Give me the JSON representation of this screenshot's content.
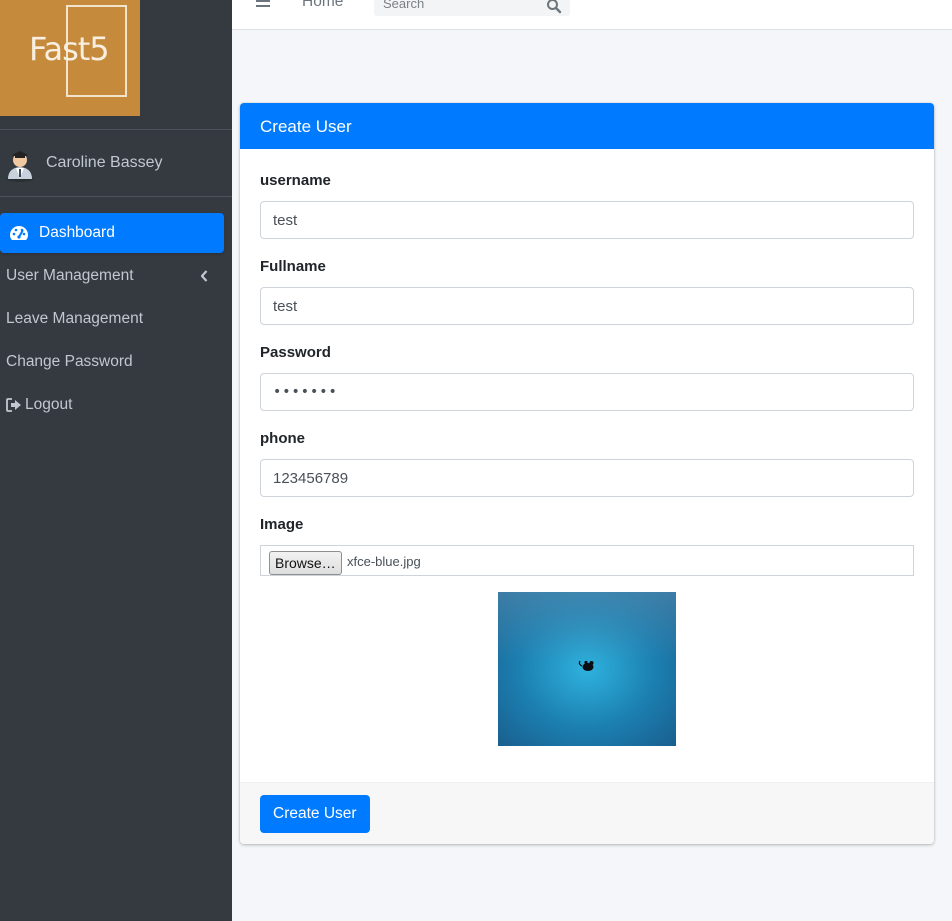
{
  "app": {
    "logo_text": "Fast5",
    "brand_color": "#c68a3c",
    "accent": "#007bff"
  },
  "sidebar": {
    "user_name": "Caroline Bassey",
    "items": [
      {
        "label": "Dashboard",
        "icon": "tachometer-icon",
        "active": true
      },
      {
        "label": "User Management",
        "icon": "chevron-left-icon"
      },
      {
        "label": "Leave Management"
      },
      {
        "label": "Change Password"
      },
      {
        "label": "Logout",
        "icon": "sign-out-icon"
      }
    ]
  },
  "topbar": {
    "home_label": "Home",
    "search_placeholder": "Search"
  },
  "form": {
    "title": "Create User",
    "fields": [
      {
        "label": "username",
        "value": "test"
      },
      {
        "label": "Fullname",
        "value": "test"
      },
      {
        "label": "Password",
        "value": "•••••••"
      },
      {
        "label": "phone",
        "value": "123456789"
      }
    ],
    "image": {
      "label": "Image",
      "browse_label": "Browse…",
      "file_name": "xfce-blue.jpg"
    },
    "submit_label": "Create User"
  }
}
